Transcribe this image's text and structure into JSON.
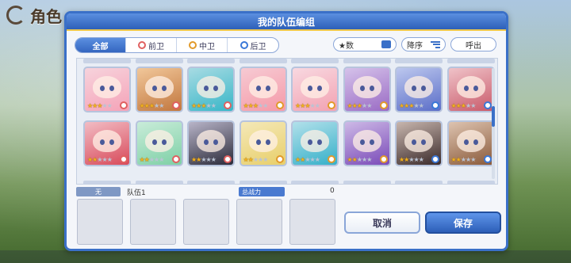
{
  "background": {
    "title": "角色"
  },
  "dialog": {
    "title": "我的队伍编组"
  },
  "filters": {
    "tabs": [
      {
        "label": "全部",
        "active": true,
        "icon": "none"
      },
      {
        "label": "前卫",
        "active": false,
        "icon": "front-role-icon"
      },
      {
        "label": "中卫",
        "active": false,
        "icon": "middle-role-icon"
      },
      {
        "label": "后卫",
        "active": false,
        "icon": "back-role-icon"
      }
    ],
    "star_sort_label": "★数",
    "order_label": "降序",
    "callout_label": "呼出"
  },
  "characters": [
    {
      "stars": 3,
      "role": "front",
      "hair": "#f5a3b8",
      "bg": "#f6d3dc"
    },
    {
      "stars": 3,
      "role": "front",
      "hair": "#c2773e",
      "bg": "#f1c79a"
    },
    {
      "stars": 3,
      "role": "front",
      "hair": "#38b6c7",
      "bg": "#a7dbe3"
    },
    {
      "stars": 3,
      "role": "middle",
      "hair": "#f59aa8",
      "bg": "#f6cad3"
    },
    {
      "stars": 3,
      "role": "middle",
      "hair": "#f2a2b2",
      "bg": "#f8d8e0"
    },
    {
      "stars": 3,
      "role": "middle",
      "hair": "#9a6bc4",
      "bg": "#d5c2ea"
    },
    {
      "stars": 3,
      "role": "back",
      "hair": "#5b6ec8",
      "bg": "#bcc7ee"
    },
    {
      "stars": 3,
      "role": "back",
      "hair": "#c95a6a",
      "bg": "#efc2c8"
    },
    {
      "stars": 2,
      "role": "front",
      "hair": "#d84a5a",
      "bg": "#f2bcc4"
    },
    {
      "stars": 2,
      "role": "front",
      "hair": "#7ed0a6",
      "bg": "#c9ecd9"
    },
    {
      "stars": 2,
      "role": "front",
      "hair": "#2b2b3a",
      "bg": "#b8b4c8"
    },
    {
      "stars": 2,
      "role": "middle",
      "hair": "#e8cf6a",
      "bg": "#f4e8b8"
    },
    {
      "stars": 2,
      "role": "middle",
      "hair": "#35b0c9",
      "bg": "#b2e0ea"
    },
    {
      "stars": 2,
      "role": "middle",
      "hair": "#7a4ab8",
      "bg": "#cdb9e6"
    },
    {
      "stars": 2,
      "role": "back",
      "hair": "#3a2a2a",
      "bg": "#c8b6ae"
    },
    {
      "stars": 2,
      "role": "back",
      "hair": "#8a5a3a",
      "bg": "#ddc3b0"
    }
  ],
  "team": {
    "none_label": "无",
    "team_name": "队伍1",
    "power_label": "总战力",
    "power_value": "0",
    "slot_count": 5
  },
  "buttons": {
    "cancel": "取消",
    "save": "保存"
  },
  "colors": {
    "accent": "#3a70c8",
    "star": "#f2b01e"
  }
}
